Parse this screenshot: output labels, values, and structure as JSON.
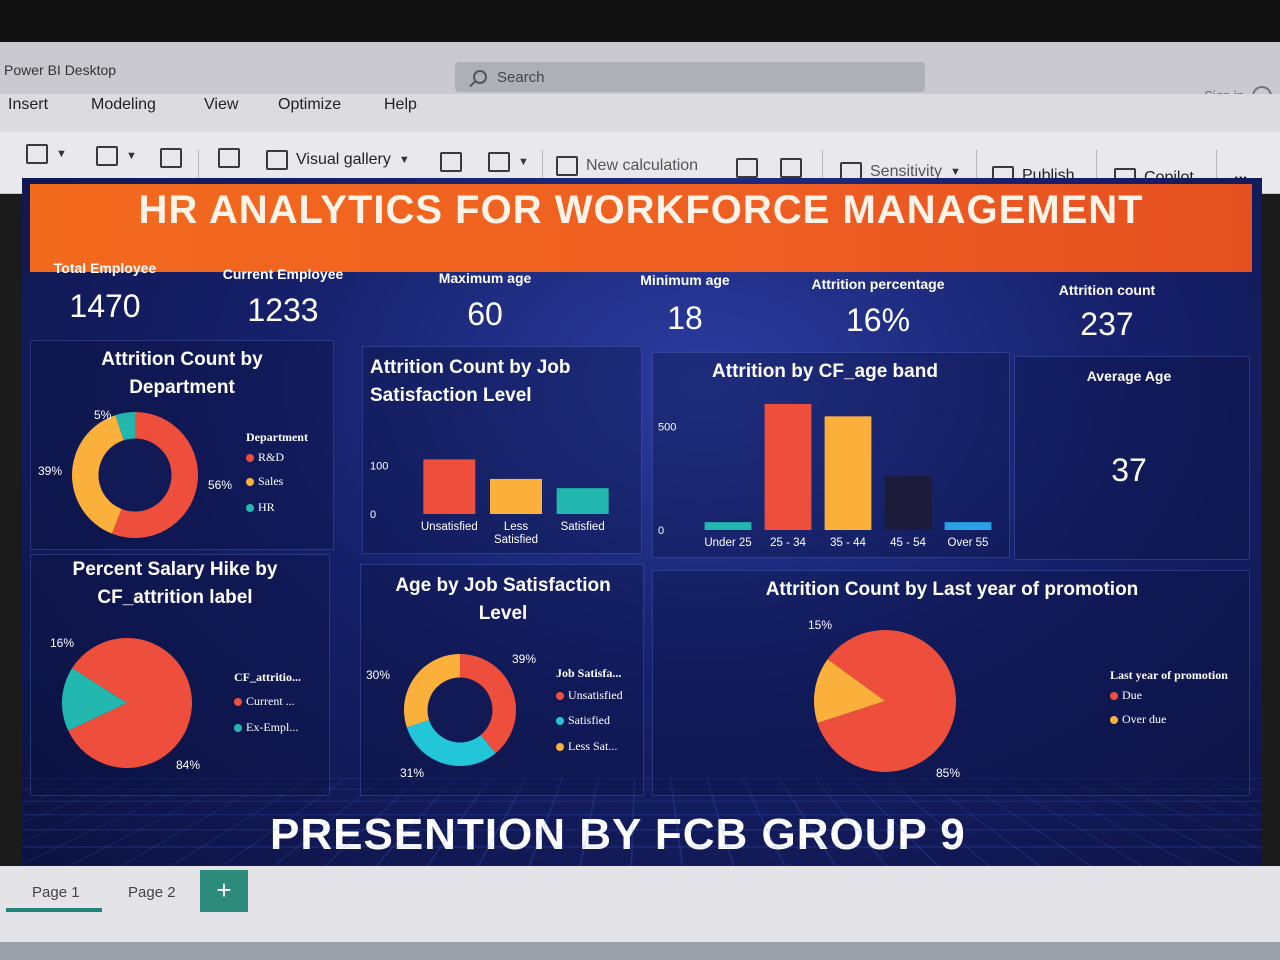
{
  "app": {
    "title": "Power BI Desktop",
    "search_placeholder": "Search",
    "signin": "Sign in"
  },
  "menu": {
    "items": [
      "Insert",
      "Modeling",
      "View",
      "Optimize",
      "Help"
    ]
  },
  "ribbon": {
    "visual_gallery": "Visual gallery",
    "new_calculation": "New calculation",
    "sensitivity": "Sensitivity",
    "publish": "Publish",
    "copilot": "Copilot",
    "more": "..."
  },
  "dashboard": {
    "title": "HR  ANALYTICS FOR WORKFORCE MANAGEMENT",
    "kpis": [
      {
        "label": "Total Employee",
        "value": "1470"
      },
      {
        "label": "Current Employee",
        "value": "1233"
      },
      {
        "label": "Maximum age",
        "value": "60"
      },
      {
        "label": "Minimum age",
        "value": "18"
      },
      {
        "label": "Attrition percentage",
        "value": "16%"
      },
      {
        "label": "Attrition count",
        "value": "237"
      }
    ],
    "avg_age": {
      "label": "Average Age",
      "value": "37"
    },
    "footer": "PRESENTION BY FCB GROUP 9"
  },
  "colors": {
    "red": "#ee4e3c",
    "orange": "#fbb03b",
    "teal": "#22b8b0",
    "dark": "#1d1a3a",
    "blue": "#2aa2e6",
    "accent": "#f26a1d"
  },
  "chart_data": [
    {
      "type": "pie",
      "title": "Attrition Count by Department",
      "legend_title": "Department",
      "categories": [
        "R&D",
        "Sales",
        "HR"
      ],
      "values": [
        56,
        39,
        5
      ],
      "labels": [
        "56%",
        "39%",
        "5%"
      ],
      "colors": [
        "#ee4e3c",
        "#fbb03b",
        "#22b8b0"
      ],
      "donut": true
    },
    {
      "type": "bar",
      "title": "Attrition Count by Job Satisfaction Level",
      "categories": [
        "Unsatisfied",
        "Less Satisfied",
        "Satisfied"
      ],
      "values": [
        112,
        72,
        53
      ],
      "colors": [
        "#ee4e3c",
        "#fbb03b",
        "#22b8b0"
      ],
      "yticks": [
        "100",
        "0"
      ],
      "ylim": [
        0,
        160
      ]
    },
    {
      "type": "bar",
      "title": "Attrition by CF_age band",
      "categories": [
        "Under 25",
        "25 - 34",
        "35 - 44",
        "45 - 54",
        "Over 55"
      ],
      "values": [
        38,
        610,
        550,
        260,
        38
      ],
      "colors": [
        "#22b8b0",
        "#ee4e3c",
        "#fbb03b",
        "#1d1a3a",
        "#2aa2e6"
      ],
      "yticks": [
        "500",
        "0"
      ],
      "ylim": [
        0,
        600
      ]
    },
    {
      "type": "pie",
      "title": "Percent Salary Hike by CF_attrition label",
      "legend_title": "CF_attritio...",
      "categories": [
        "Current ...",
        "Ex-Empl..."
      ],
      "values": [
        84,
        16
      ],
      "labels": [
        "84%",
        "16%"
      ],
      "colors": [
        "#ee4e3c",
        "#22b8b0"
      ],
      "donut": false
    },
    {
      "type": "pie",
      "title": "Age by Job Satisfaction Level",
      "legend_title": "Job Satisfa...",
      "categories": [
        "Unsatisfied",
        "Satisfied",
        "Less Sat..."
      ],
      "values": [
        39,
        31,
        30
      ],
      "labels": [
        "39%",
        "31%",
        "30%"
      ],
      "colors": [
        "#ee4e3c",
        "#22c6d8",
        "#fbb03b"
      ],
      "donut": true
    },
    {
      "type": "pie",
      "title": "Attrition Count by Last year of promotion",
      "legend_title": "Last year of promotion",
      "categories": [
        "Due",
        "Over due"
      ],
      "values": [
        85,
        15
      ],
      "labels": [
        "85%",
        "15%"
      ],
      "colors": [
        "#ee4e3c",
        "#fbb03b"
      ],
      "donut": false
    }
  ],
  "tabs": {
    "page1": "Page 1",
    "page2": "Page 2",
    "add": "+"
  }
}
